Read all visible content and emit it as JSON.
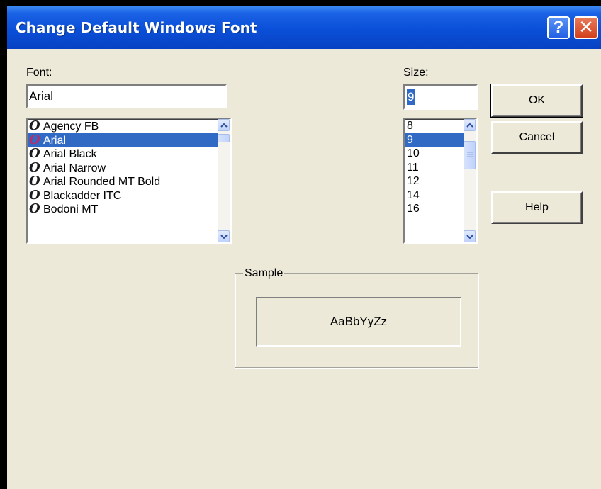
{
  "dialog": {
    "title": "Change Default Windows Font"
  },
  "font": {
    "label": "Font:",
    "value": "Arial",
    "items": [
      {
        "name": "Agency FB"
      },
      {
        "name": "Arial"
      },
      {
        "name": "Arial Black"
      },
      {
        "name": "Arial Narrow"
      },
      {
        "name": "Arial Rounded MT Bold"
      },
      {
        "name": "Blackadder ITC"
      },
      {
        "name": "Bodoni MT"
      }
    ],
    "selected_index": 1,
    "item_icon": "opentype-font-icon",
    "item_icon_glyph": "O"
  },
  "size": {
    "label": "Size:",
    "value": "9",
    "items": [
      "8",
      "9",
      "10",
      "11",
      "12",
      "14",
      "16"
    ],
    "selected_index": 1
  },
  "buttons": {
    "ok": "OK",
    "cancel": "Cancel",
    "help": "Help"
  },
  "sample": {
    "label": "Sample",
    "text": "AaBbYyZz"
  },
  "titlebar_buttons": {
    "help_glyph": "?",
    "close_glyph": "✕"
  },
  "colors": {
    "selection": "#316ac5",
    "titlebar": "#0a4fd8",
    "dialog_bg": "#ece9d8"
  }
}
